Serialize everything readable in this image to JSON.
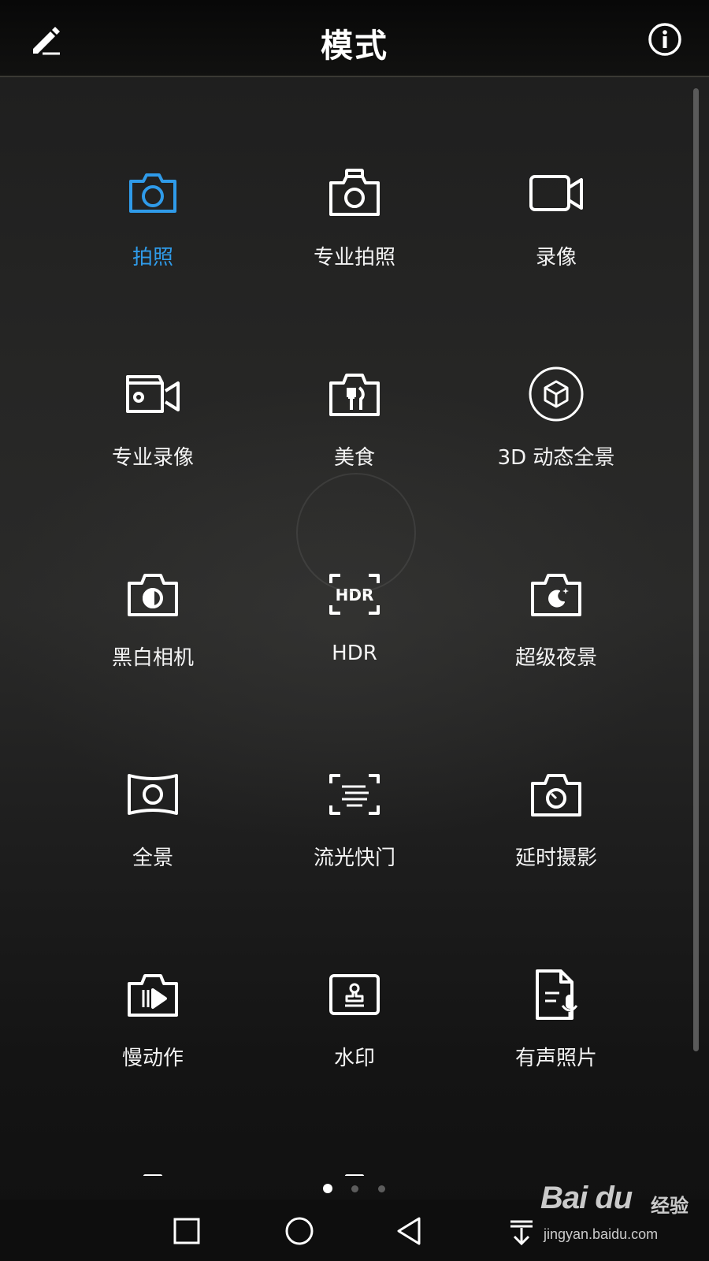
{
  "header": {
    "title": "模式",
    "edit_icon": "pencil-edit-icon",
    "info_icon": "info-circle-icon"
  },
  "colors": {
    "accent": "#2f9be9",
    "text": "#f4f4f4",
    "background": "#1a1a1a"
  },
  "modes": [
    {
      "label": "拍照",
      "icon": "camera-icon",
      "selected": true
    },
    {
      "label": "专业拍照",
      "icon": "pro-camera-icon",
      "selected": false
    },
    {
      "label": "录像",
      "icon": "video-camera-icon",
      "selected": false
    },
    {
      "label": "专业录像",
      "icon": "pro-video-icon",
      "selected": false
    },
    {
      "label": "美食",
      "icon": "food-fork-knife-icon",
      "selected": false
    },
    {
      "label": "3D 动态全景",
      "icon": "3d-cube-icon",
      "selected": false
    },
    {
      "label": "黑白相机",
      "icon": "monochrome-camera-icon",
      "selected": false
    },
    {
      "label": "HDR",
      "icon": "hdr-icon",
      "selected": false
    },
    {
      "label": "超级夜景",
      "icon": "night-moon-camera-icon",
      "selected": false
    },
    {
      "label": "全景",
      "icon": "panorama-icon",
      "selected": false
    },
    {
      "label": "流光快门",
      "icon": "light-painting-icon",
      "selected": false
    },
    {
      "label": "延时摄影",
      "icon": "timelapse-camera-icon",
      "selected": false
    },
    {
      "label": "慢动作",
      "icon": "slow-motion-icon",
      "selected": false
    },
    {
      "label": "水印",
      "icon": "watermark-stamp-icon",
      "selected": false
    },
    {
      "label": "有声照片",
      "icon": "audio-photo-icon",
      "selected": false
    }
  ],
  "pagination": {
    "pages": 3,
    "current": 1
  },
  "navbar": {
    "recent_icon": "recent-apps-square-icon",
    "home_icon": "home-circle-icon",
    "back_icon": "back-triangle-icon",
    "drawer_icon": "pull-down-drawer-icon"
  },
  "watermark": {
    "logo": "Bai du",
    "logo_cn": "经验",
    "url": "jingyan.baidu.com"
  }
}
